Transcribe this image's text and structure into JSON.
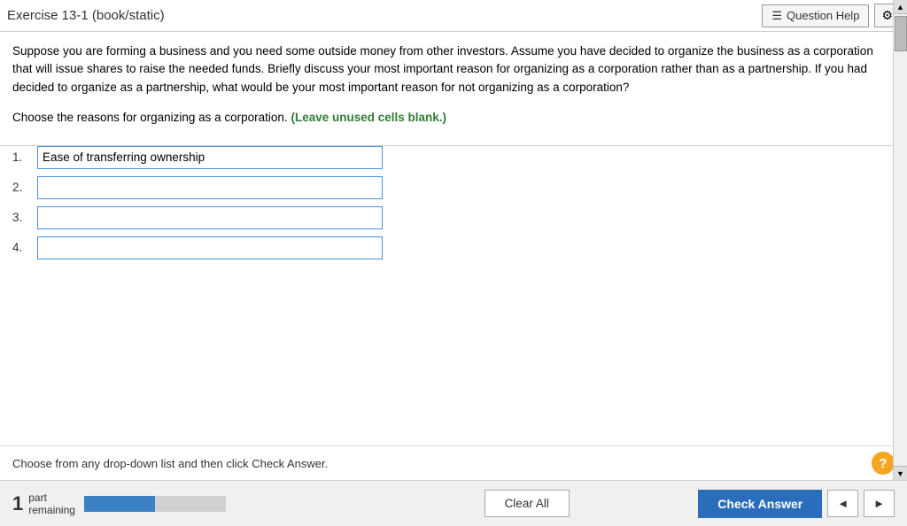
{
  "header": {
    "title": "Exercise 13-1 (book/static)",
    "question_help_label": "Question Help",
    "gear_icon": "⚙"
  },
  "question": {
    "text": "Suppose you are forming a business and you need some outside money from other investors. Assume you have decided to organize the business as a corporation that will issue shares to raise the needed funds. Briefly discuss your most important reason for organizing as a corporation rather than as a partnership. If you had decided to organize as a partnership, what would be your most important reason for not organizing as a corporation?",
    "instruction_prefix": "Choose the reasons for organizing as a corporation.",
    "instruction_highlight": "(Leave unused cells blank.)"
  },
  "answers": [
    {
      "number": "1.",
      "value": "Ease of transferring ownership"
    },
    {
      "number": "2.",
      "value": ""
    },
    {
      "number": "3.",
      "value": ""
    },
    {
      "number": "4.",
      "value": ""
    }
  ],
  "status": {
    "text": "Choose from any drop-down list and then click Check Answer."
  },
  "footer": {
    "part_number": "1",
    "part_label": "part",
    "remaining_label": "remaining",
    "clear_all_label": "Clear All",
    "check_answer_label": "Check Answer",
    "nav_prev": "◄",
    "nav_next": "►"
  }
}
